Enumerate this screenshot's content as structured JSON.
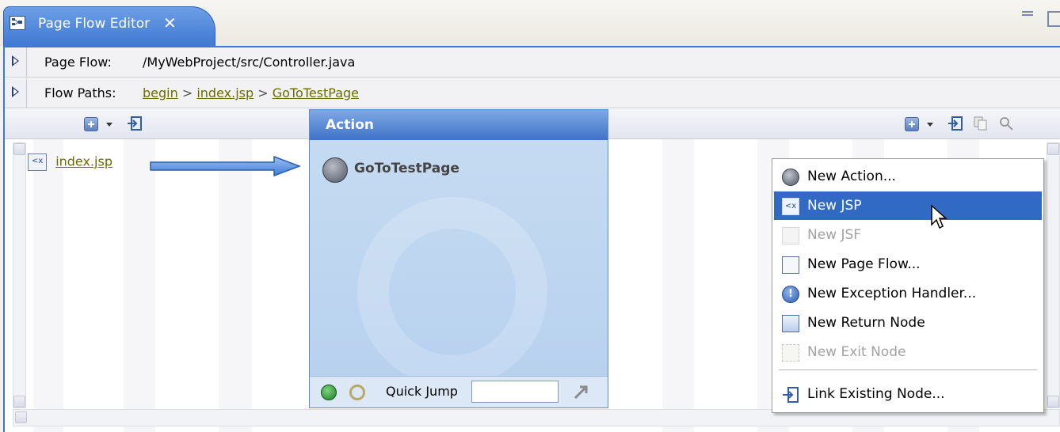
{
  "tab": {
    "title": "Page Flow Editor",
    "close": "✕"
  },
  "page_flow": {
    "label": "Page Flow:",
    "path": "/MyWebProject/src/Controller.java"
  },
  "flow_paths": {
    "label": "Flow Paths:",
    "crumbs": [
      "begin",
      "index.jsp",
      "GoToTestPage"
    ],
    "separator": ">"
  },
  "left_column": {
    "node_label": "index.jsp"
  },
  "action_column": {
    "header": "Action",
    "node_label": "GoToTestPage",
    "quick_jump_label": "Quick Jump",
    "quick_jump_value": ""
  },
  "context_menu": {
    "items": [
      {
        "label": "New Action...",
        "icon": "action-icon",
        "state": "normal"
      },
      {
        "label": "New JSP",
        "icon": "jsp-icon",
        "state": "selected"
      },
      {
        "label": "New JSF",
        "icon": "jsf-icon",
        "state": "disabled"
      },
      {
        "label": "New Page Flow...",
        "icon": "page-flow-icon",
        "state": "normal"
      },
      {
        "label": "New Exception Handler...",
        "icon": "exception-handler-icon",
        "state": "normal"
      },
      {
        "label": "New Return Node",
        "icon": "return-node-icon",
        "state": "normal"
      },
      {
        "label": "New Exit Node",
        "icon": "exit-node-icon",
        "state": "disabled"
      },
      {
        "label": "Link Existing Node...",
        "icon": "link-node-icon",
        "state": "normal"
      }
    ]
  },
  "colors": {
    "tab_blue": "#3f78d3",
    "menu_selection": "#316ac5",
    "link_olive": "#6b6b00",
    "action_header": "#3f73c8"
  }
}
